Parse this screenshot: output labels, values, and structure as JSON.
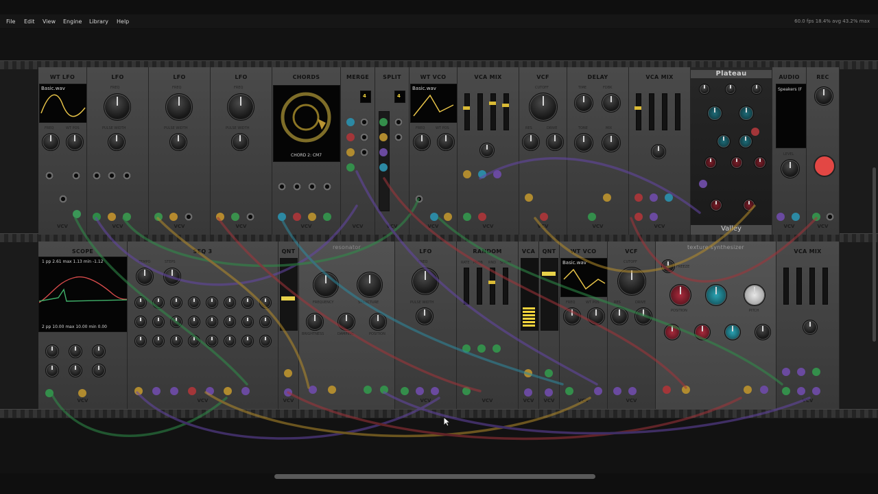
{
  "menu": {
    "items": [
      "File",
      "Edit",
      "View",
      "Engine",
      "Library",
      "Help"
    ],
    "stats": "60.0 fps  18.4% avg  43.2% max"
  },
  "row1_modules": [
    {
      "title": "WT LFO",
      "brand": "VCV"
    },
    {
      "title": "LFO",
      "brand": "VCV"
    },
    {
      "title": "LFO",
      "brand": "VCV"
    },
    {
      "title": "LFO",
      "brand": "VCV"
    },
    {
      "title": "CHORDS",
      "brand": "VCV"
    },
    {
      "title": "MERGE",
      "brand": "VCV"
    },
    {
      "title": "SPLIT",
      "brand": "VCV"
    },
    {
      "title": "WT VCO",
      "brand": "VCV"
    },
    {
      "title": "VCA MIX",
      "brand": "VCV"
    },
    {
      "title": "VCF",
      "brand": "VCV"
    },
    {
      "title": "DELAY",
      "brand": "VCV"
    },
    {
      "title": "VCA MIX",
      "brand": "VCV"
    },
    {
      "title": "Plateau",
      "brand": "Valley"
    },
    {
      "title": "AUDIO",
      "brand": "VCV"
    },
    {
      "title": "REC",
      "brand": "VCV"
    }
  ],
  "row2_modules": [
    {
      "title": "SCOPE",
      "brand": "VCV"
    },
    {
      "title": "SEQ 3",
      "brand": "VCV"
    },
    {
      "title": "QNT",
      "brand": "VCV"
    },
    {
      "title": "resonator",
      "brand": ""
    },
    {
      "title": "LFO",
      "brand": "VCV"
    },
    {
      "title": "RANDOM",
      "brand": "VCV"
    },
    {
      "title": "VCA",
      "brand": "VCV"
    },
    {
      "title": "QNT",
      "brand": "VCV"
    },
    {
      "title": "WT VCO",
      "brand": "VCV"
    },
    {
      "title": "VCF",
      "brand": "VCV"
    },
    {
      "title": "texture synthesizer",
      "brand": ""
    },
    {
      "title": "VCA MIX",
      "brand": "VCV"
    }
  ],
  "displays": {
    "wt_lfo_file": "Basic.wav",
    "wt_vco_file": "Basic.wav",
    "wt_vco2_file": "Basic.wav",
    "audio_device": "Speakers (F",
    "chords_label": "CHORD 2: CM7",
    "merge_count": "4",
    "split_count": "4",
    "scope_top": "1  pp  2.61  max  1.13  min  -1.12",
    "scope_bottom": "2  pp  10.00  max  10.00  min  0.00"
  },
  "labels": {
    "freq": "FREQ",
    "wt_pos": "WT POS",
    "pulse_width": "PULSE WIDTH",
    "cutoff": "CUTOFF",
    "res": "RES",
    "drive": "DRIVE",
    "time": "TIME",
    "fdbk": "FDBK",
    "tone": "TONE",
    "mix": "MIX",
    "level": "LEVEL",
    "tempo": "TEMPO",
    "steps": "STEPS",
    "frequency": "FREQUENCY",
    "structure": "STRUCTURE",
    "brightness": "BRIGHTNESS",
    "damping": "DAMPING",
    "position": "POSITION",
    "rate": "RATE",
    "prob": "PROB",
    "rnd": "RND",
    "shape": "SHAPE",
    "freeze": "FREEZE",
    "pitch": "PITCH"
  },
  "colors": {
    "panel": "#3d3d3d",
    "screen": "#050505",
    "led_yellow": "#e8d24a",
    "led_white": "#f2f2f2",
    "led_red": "#d93a3a",
    "cable_green": "#2f8f4a",
    "cable_purple": "#6546a8",
    "cable_red": "#a3343a",
    "cable_yellow": "#b58c2a",
    "cable_blue": "#2d8aa0"
  }
}
